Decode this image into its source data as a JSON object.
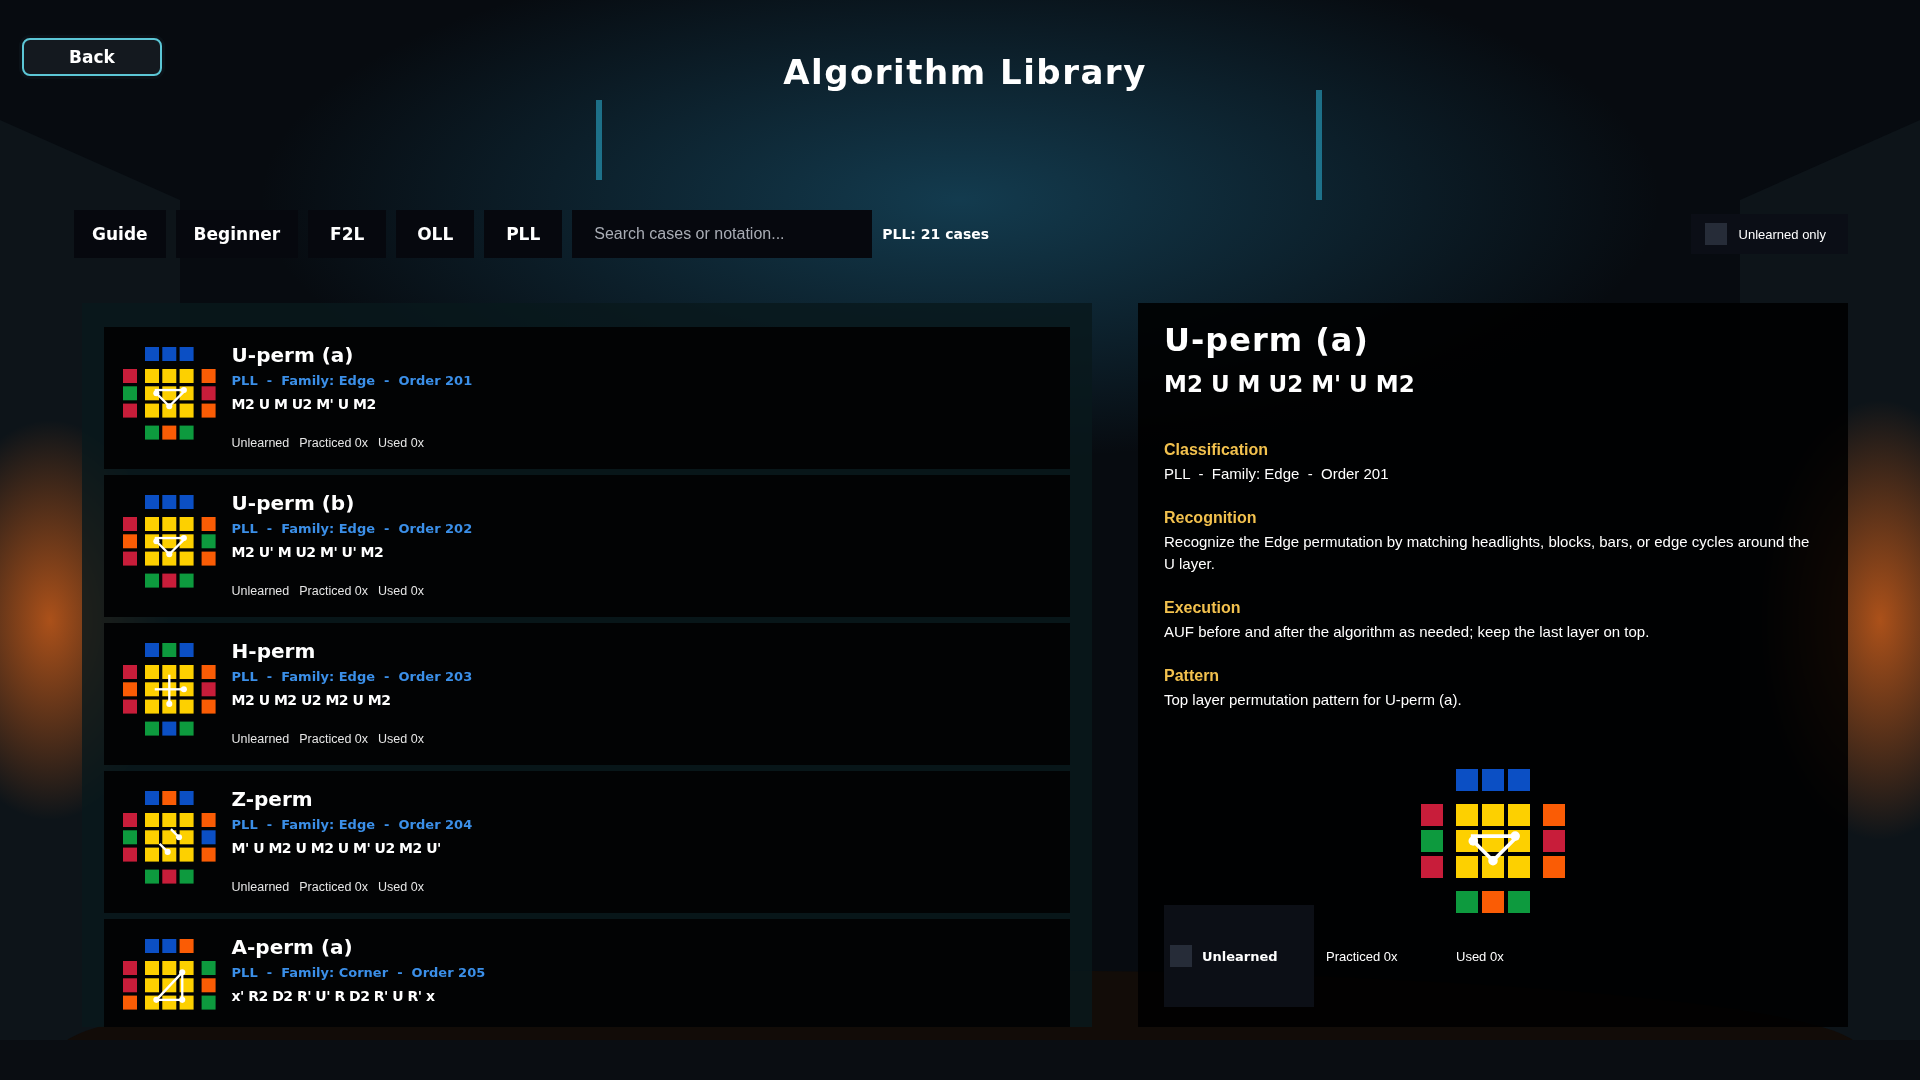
{
  "back_button": "Back",
  "title": "Algorithm Library",
  "tabs": [
    "Guide",
    "Beginner",
    "F2L",
    "OLL",
    "PLL"
  ],
  "search": {
    "placeholder": "Search cases or notation..."
  },
  "case_count": "PLL: 21 cases",
  "filter": {
    "label": "Unlearned only",
    "checked": false
  },
  "cases": [
    {
      "name": "U-perm (a)",
      "meta": "PLL  -  Family: Edge  -  Order 201",
      "formula": "M2 U M U2 M' U M2",
      "status": [
        "Unlearned",
        "Practiced 0x",
        "Used 0x"
      ],
      "pattern": {
        "kind": "cycle",
        "top": [
          {
            "color": "#0b4fc4"
          },
          {
            "color": "#0b4fc4"
          },
          {
            "color": "#0b4fc4"
          }
        ],
        "left": [
          {
            "color": "#c81d3a"
          },
          {
            "color": "#0d9a3e"
          },
          {
            "color": "#c81d3a"
          }
        ],
        "right": [
          {
            "color": "#fa5c05"
          },
          {
            "color": "#c81d3a"
          },
          {
            "color": "#fa5c05"
          }
        ],
        "bottom": [
          {
            "color": "#0d9a3e"
          },
          {
            "color": "#fa5c05"
          },
          {
            "color": "#0d9a3e"
          }
        ]
      }
    },
    {
      "name": "U-perm (b)",
      "meta": "PLL  -  Family: Edge  -  Order 202",
      "formula": "M2 U' M U2 M' U' M2",
      "status": [
        "Unlearned",
        "Practiced 0x",
        "Used 0x"
      ],
      "pattern": {
        "kind": "cycle",
        "top": [
          {
            "color": "#0b4fc4"
          },
          {
            "color": "#0b4fc4"
          },
          {
            "color": "#0b4fc4"
          }
        ],
        "left": [
          {
            "color": "#c81d3a"
          },
          {
            "color": "#fa5c05"
          },
          {
            "color": "#c81d3a"
          }
        ],
        "right": [
          {
            "color": "#fa5c05"
          },
          {
            "color": "#0d9a3e"
          },
          {
            "color": "#fa5c05"
          }
        ],
        "bottom": [
          {
            "color": "#0d9a3e"
          },
          {
            "color": "#c81d3a"
          },
          {
            "color": "#0d9a3e"
          }
        ]
      }
    },
    {
      "name": "H-perm",
      "meta": "PLL  -  Family: Edge  -  Order 203",
      "formula": "M2 U M2 U2 M2 U M2",
      "status": [
        "Unlearned",
        "Practiced 0x",
        "Used 0x"
      ],
      "pattern": {
        "kind": "cross",
        "top": [
          {
            "color": "#0b4fc4"
          },
          {
            "color": "#0d9a3e"
          },
          {
            "color": "#0b4fc4"
          }
        ],
        "left": [
          {
            "color": "#c81d3a"
          },
          {
            "color": "#fa5c05"
          },
          {
            "color": "#c81d3a"
          }
        ],
        "right": [
          {
            "color": "#fa5c05"
          },
          {
            "color": "#c81d3a"
          },
          {
            "color": "#fa5c05"
          }
        ],
        "bottom": [
          {
            "color": "#0d9a3e"
          },
          {
            "color": "#0b4fc4"
          },
          {
            "color": "#0d9a3e"
          }
        ]
      }
    },
    {
      "name": "Z-perm",
      "meta": "PLL  -  Family: Edge  -  Order 204",
      "formula": "M' U M2 U M2 U M' U2 M2 U'",
      "status": [
        "Unlearned",
        "Practiced 0x",
        "Used 0x"
      ],
      "pattern": {
        "kind": "diagonal",
        "top": [
          {
            "color": "#0b4fc4"
          },
          {
            "color": "#fa5c05"
          },
          {
            "color": "#0b4fc4"
          }
        ],
        "left": [
          {
            "color": "#c81d3a"
          },
          {
            "color": "#0d9a3e"
          },
          {
            "color": "#c81d3a"
          }
        ],
        "right": [
          {
            "color": "#fa5c05"
          },
          {
            "color": "#0b4fc4"
          },
          {
            "color": "#fa5c05"
          }
        ],
        "bottom": [
          {
            "color": "#0d9a3e"
          },
          {
            "color": "#c81d3a"
          },
          {
            "color": "#0d9a3e"
          }
        ]
      }
    },
    {
      "name": "A-perm (a)",
      "meta": "PLL  -  Family: Corner  -  Order 205",
      "formula": "x' R2 D2 R' U' R D2 R' U R' x",
      "pattern": {
        "kind": "corner",
        "top": [
          {
            "color": "#0b4fc4"
          },
          {
            "color": "#0b4fc4"
          },
          {
            "color": "#fa5c05"
          }
        ],
        "left": [
          {
            "color": "#c81d3a"
          },
          {
            "color": "#c81d3a"
          },
          {
            "color": "#fa5c05"
          }
        ],
        "right": [
          {
            "color": "#0d9a3e"
          },
          {
            "color": "#fa5c05"
          },
          {
            "color": "#0d9a3e"
          }
        ]
      }
    }
  ],
  "detail": {
    "title": "U-perm (a)",
    "formula": "M2 U M U2 M' U M2",
    "sections": [
      {
        "heading": "Classification",
        "text": "PLL  -  Family: Edge  -  Order 201"
      },
      {
        "heading": "Recognition",
        "text": "Recognize the Edge permutation by matching headlights, blocks, bars, or edge cycles around the U layer."
      },
      {
        "heading": "Execution",
        "text": "AUF before and after the algorithm as needed; keep the last layer on top."
      },
      {
        "heading": "Pattern",
        "text": "Top layer permutation pattern for U-perm (a)."
      }
    ],
    "pattern": {
      "kind": "cycle",
      "top": [
        {
          "color": "#0b4fc4"
        },
        {
          "color": "#0b4fc4"
        },
        {
          "color": "#0b4fc4"
        }
      ],
      "left": [
        {
          "color": "#c81d3a"
        },
        {
          "color": "#0d9a3e"
        },
        {
          "color": "#c81d3a"
        }
      ],
      "right": [
        {
          "color": "#fa5c05"
        },
        {
          "color": "#c81d3a"
        },
        {
          "color": "#fa5c05"
        }
      ],
      "bottom": [
        {
          "color": "#0d9a3e"
        },
        {
          "color": "#fa5c05"
        },
        {
          "color": "#0d9a3e"
        }
      ]
    },
    "learned": {
      "label": "Unlearned",
      "checked": false
    },
    "practiced": "Practiced 0x",
    "used": "Used 0x"
  }
}
